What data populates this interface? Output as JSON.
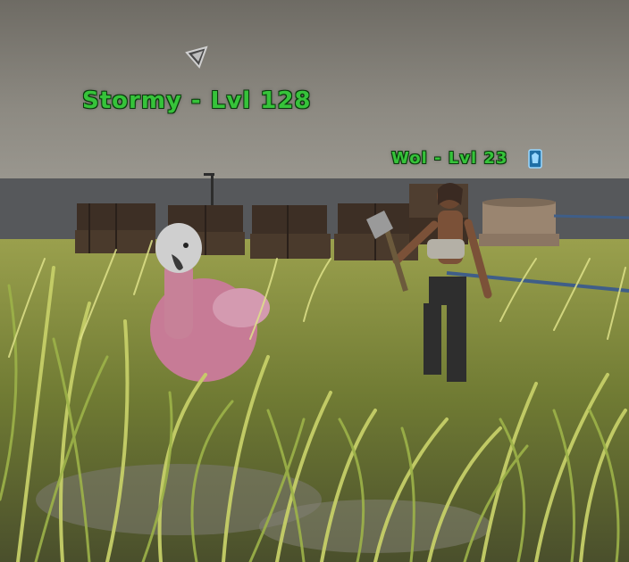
{
  "hud": {
    "creatures": [
      {
        "name": "Stormy",
        "separator": "-",
        "level_label": "Lvl",
        "level": "128",
        "display": "Stormy - Lvl 128"
      },
      {
        "name": "Wol",
        "separator": "-",
        "level_label": "Lvl",
        "level": "23",
        "display": "Wol - Lvl 23"
      }
    ],
    "tribe_icon": "tribe-badge-icon",
    "waypoint_icon": "waypoint-marker-icon",
    "nameplate_color": "#36c33a"
  },
  "scene": {
    "sky_color": "#7d7a72",
    "water_color": "#55575a",
    "grass_color": "#b7c25a"
  }
}
